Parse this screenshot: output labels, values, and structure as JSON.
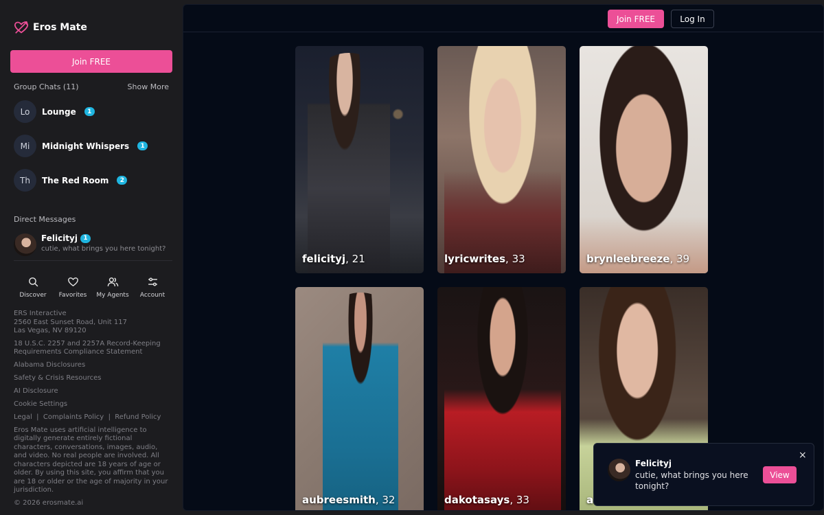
{
  "brand": {
    "name": "Eros Mate",
    "accent": "#ec4f97"
  },
  "sidebar": {
    "join_label": "Join FREE",
    "group_chats": {
      "title": "Group Chats (11)",
      "show_more": "Show More",
      "items": [
        {
          "initials": "Lo",
          "name": "Lounge",
          "badge": "1"
        },
        {
          "initials": "Mi",
          "name": "Midnight Whispers",
          "badge": "1"
        },
        {
          "initials": "Th",
          "name": "The Red Room",
          "badge": "2"
        }
      ]
    },
    "direct_messages": {
      "title": "Direct Messages",
      "items": [
        {
          "name": "Felicityj",
          "badge": "1",
          "message": "cutie, what brings you here tonight?"
        }
      ]
    },
    "nav": [
      {
        "label": "Discover",
        "icon": "search-icon"
      },
      {
        "label": "Favorites",
        "icon": "heart-icon"
      },
      {
        "label": "My Agents",
        "icon": "users-icon"
      },
      {
        "label": "Account",
        "icon": "sliders-icon"
      }
    ],
    "footer": {
      "company": "ERS Interactive",
      "address1": "2560 East Sunset Road, Unit 117",
      "address2": "Las Vegas, NV 89120",
      "compliance1": "18 U.S.C. 2257 and 2257A Record-Keeping",
      "compliance2": "Requirements Compliance Statement",
      "links": [
        "Alabama Disclosures",
        "Safety & Crisis Resources",
        "AI Disclosure",
        "Cookie Settings"
      ],
      "legal": "Legal",
      "complaints": "Complaints Policy",
      "refund": "Refund Policy",
      "separator": "|",
      "disclaimer": "Eros Mate uses artificial intelligence to digitally generate entirely fictional characters, conversations, images, audio, and video. No real people are involved. All characters depicted are 18 years of age or older. By using this site, you affirm that you are 18 or older or the age of majority in your jurisdiction.",
      "copyright": "© 2026 erosmate.ai"
    }
  },
  "topbar": {
    "join_label": "Join FREE",
    "login_label": "Log In"
  },
  "cards": [
    {
      "name": "felicityj",
      "age": ", 21"
    },
    {
      "name": "lyricwrites",
      "age": ", 33"
    },
    {
      "name": "brynleebreeze",
      "age": ", 39"
    },
    {
      "name": "aubreesmith",
      "age": ", 32"
    },
    {
      "name": "dakotasays",
      "age": ", 33"
    },
    {
      "name": "a",
      "age": ""
    }
  ],
  "toast": {
    "name": "Felicityj",
    "message": "cutie, what brings you here tonight?",
    "view_label": "View",
    "close_label": "×"
  }
}
